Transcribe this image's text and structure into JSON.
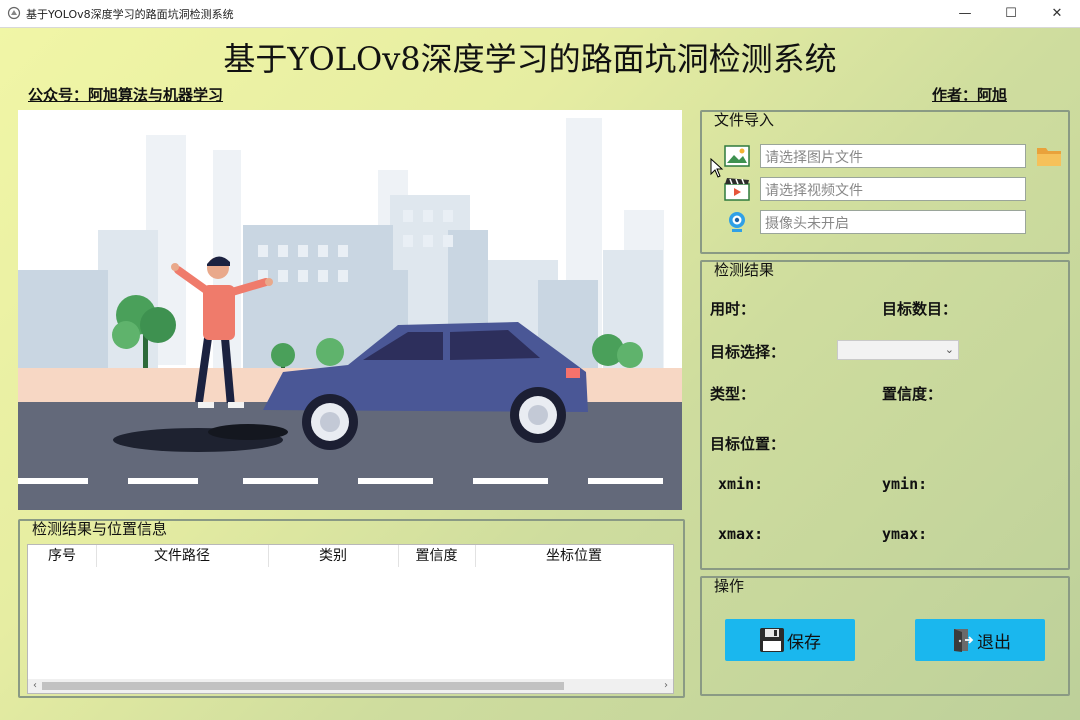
{
  "window": {
    "title": "基于YOLOv8深度学习的路面坑洞检测系统",
    "minimize": "—",
    "maximize": "☐",
    "close": "✕"
  },
  "header": {
    "title": "基于YOLOv8深度学习的路面坑洞检测系统",
    "account": "公众号：阿旭算法与机器学习",
    "author": "作者：阿旭"
  },
  "file_import": {
    "title": "文件导入",
    "image_placeholder": "请选择图片文件",
    "video_placeholder": "请选择视频文件",
    "camera_placeholder": "摄像头未开启",
    "icons": [
      "image-icon",
      "video-icon",
      "camera-icon",
      "folder-icon"
    ]
  },
  "results": {
    "title": "检测结果",
    "time_label": "用时：",
    "count_label": "目标数目：",
    "select_label": "目标选择：",
    "type_label": "类型：",
    "conf_label": "置信度：",
    "position_label": "目标位置：",
    "xmin_label": "xmin:",
    "ymin_label": "ymin:",
    "xmax_label": "xmax:",
    "ymax_label": "ymax:"
  },
  "table": {
    "title": "检测结果与位置信息",
    "columns": [
      "序号",
      "文件路径",
      "类别",
      "置信度",
      "坐标位置"
    ]
  },
  "operations": {
    "title": "操作",
    "save_label": "保存",
    "exit_label": "退出"
  },
  "colors": {
    "button": "#1ab7ee",
    "panel_border": "#8a9a84"
  }
}
